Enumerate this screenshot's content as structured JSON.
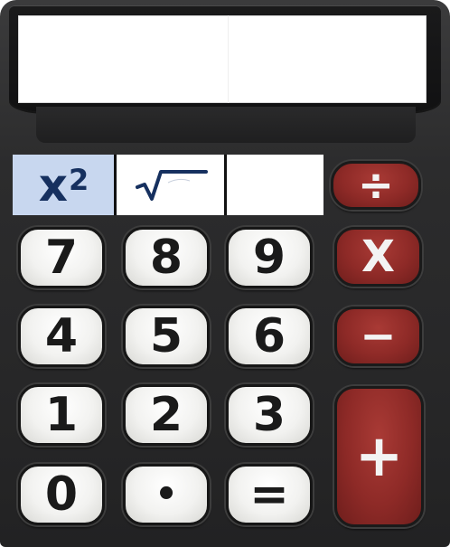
{
  "display": {
    "value": ""
  },
  "function_keys": {
    "square_base": "x",
    "square_exp": "2",
    "sqrt_symbol": "√",
    "blank_label": ""
  },
  "keys": {
    "seven": "7",
    "eight": "8",
    "nine": "9",
    "four": "4",
    "five": "5",
    "six": "6",
    "one": "1",
    "two": "2",
    "three": "3",
    "zero": "0",
    "decimal": "•",
    "equals": "=",
    "divide": "÷",
    "multiply": "X",
    "subtract": "−",
    "add": "+"
  },
  "colors": {
    "body": "#2c2c2d",
    "number_key": "#f2f2f0",
    "operator_key": "#8e2a27",
    "square_key_bg": "#c8d7ef",
    "square_key_text": "#16305f"
  }
}
